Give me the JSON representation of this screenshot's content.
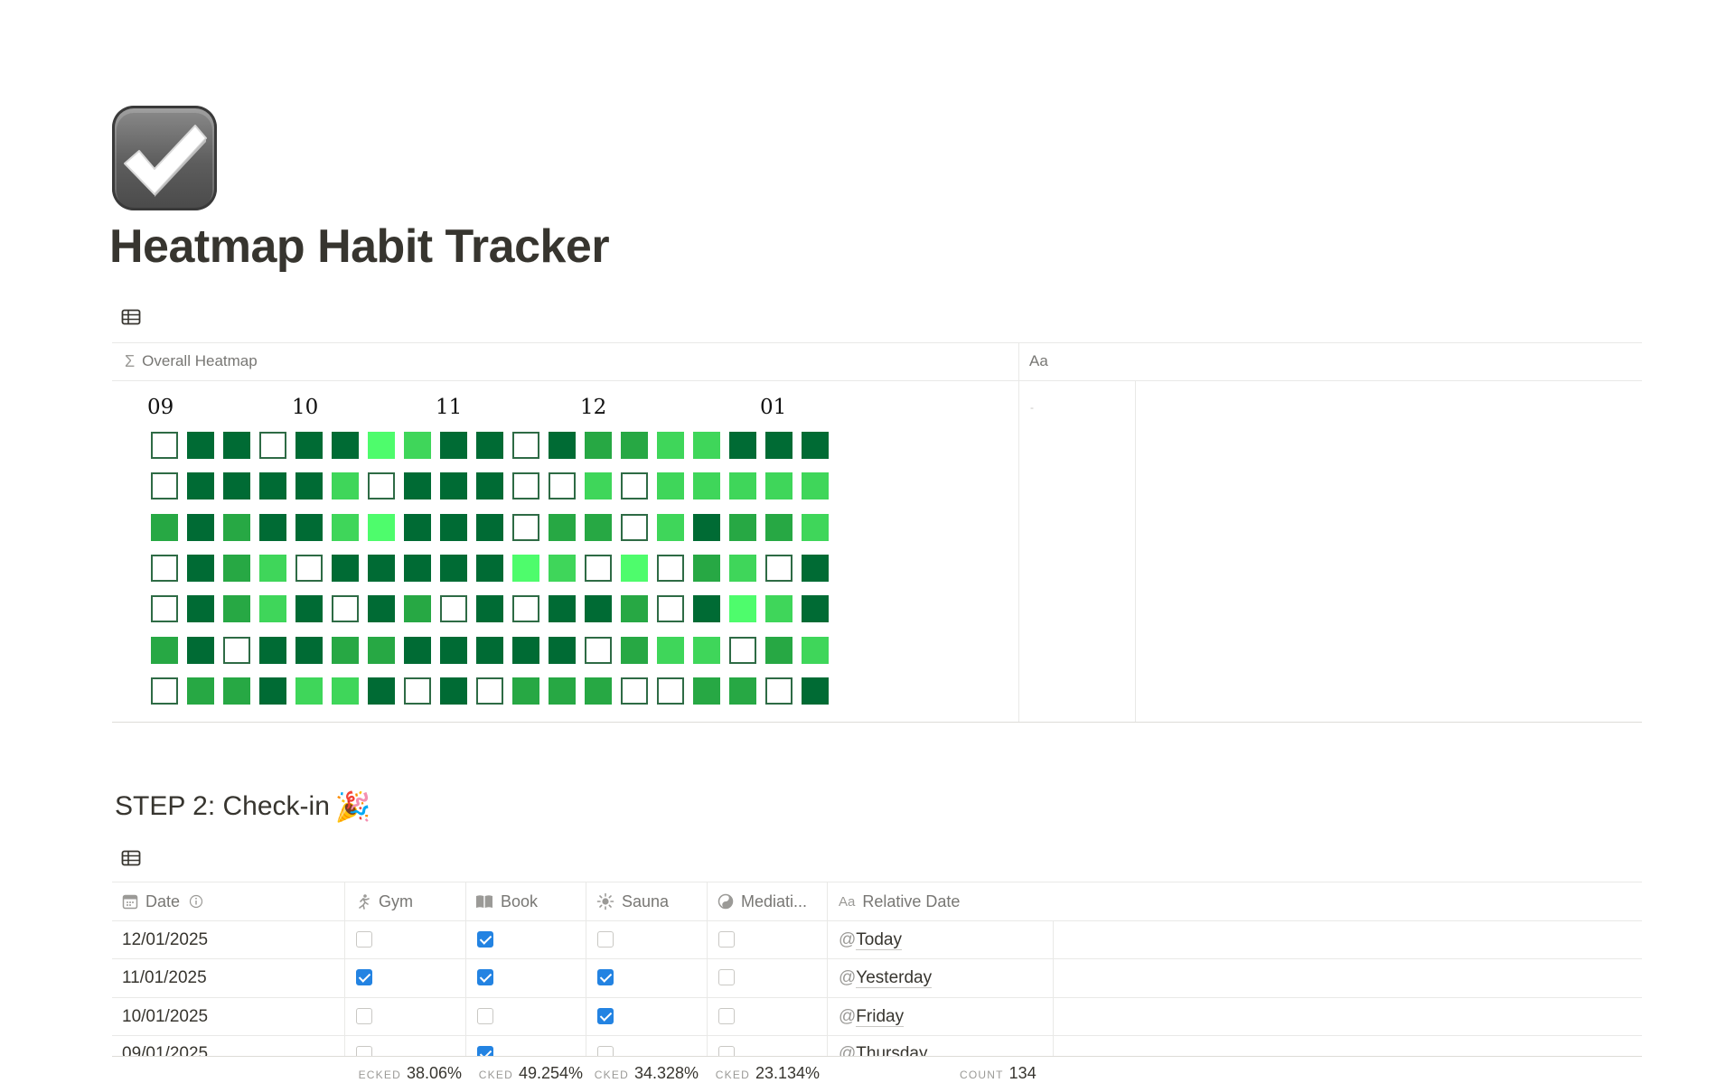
{
  "page": {
    "icon": "check-mark-button-icon",
    "title": "Heatmap Habit Tracker"
  },
  "heatmap_table": {
    "view_icon": "table-icon",
    "columns": [
      {
        "icon": "sigma-icon",
        "icon_glyph": "Σ",
        "label": "Overall Heatmap"
      },
      {
        "icon": "text-property-icon",
        "icon_glyph": "",
        "label": "Aa"
      }
    ],
    "empty_value": "-",
    "months": [
      "09",
      "10",
      "11",
      "12",
      "01"
    ],
    "colors": {
      "level_0": "#ffffff",
      "level_0_border": "#2e6b45",
      "level_1": "#4efc6c",
      "level_2": "#3fd65a",
      "level_3": "#27a844",
      "level_4": "#006b34"
    },
    "grid": [
      [
        0,
        4,
        4,
        0,
        4,
        4,
        1,
        2,
        4,
        4,
        0,
        4,
        3,
        3,
        2,
        2,
        4,
        4,
        4
      ],
      [
        0,
        4,
        4,
        4,
        4,
        2,
        0,
        4,
        4,
        4,
        0,
        0,
        2,
        0,
        2,
        2,
        2,
        2,
        2
      ],
      [
        3,
        4,
        3,
        4,
        4,
        2,
        1,
        4,
        4,
        4,
        0,
        3,
        3,
        0,
        2,
        4,
        3,
        3,
        2
      ],
      [
        0,
        4,
        3,
        2,
        0,
        4,
        4,
        4,
        4,
        4,
        1,
        2,
        0,
        1,
        0,
        3,
        2,
        0,
        4
      ],
      [
        0,
        4,
        3,
        2,
        4,
        0,
        4,
        3,
        0,
        4,
        0,
        4,
        4,
        3,
        0,
        4,
        1,
        2,
        4
      ],
      [
        3,
        4,
        0,
        4,
        4,
        3,
        3,
        4,
        4,
        4,
        4,
        4,
        0,
        3,
        2,
        2,
        0,
        3,
        2
      ],
      [
        0,
        3,
        3,
        4,
        2,
        2,
        4,
        0,
        4,
        0,
        3,
        3,
        3,
        0,
        0,
        3,
        3,
        0,
        4
      ]
    ]
  },
  "step2": {
    "heading": "STEP 2: Check-in",
    "heading_emoji": "🎉",
    "view_icon": "table-icon",
    "columns": [
      {
        "icon": "calendar-icon",
        "label": "Date",
        "info_icon": "info-icon"
      },
      {
        "icon": "running-person-icon",
        "label": "Gym"
      },
      {
        "icon": "open-book-icon",
        "label": "Book"
      },
      {
        "icon": "sun-icon",
        "label": "Sauna"
      },
      {
        "icon": "yin-yang-icon",
        "label": "Mediati..."
      },
      {
        "icon": "text-property-icon",
        "icon_glyph": "Aa",
        "label": "Relative Date"
      }
    ],
    "rows": [
      {
        "date": "12/01/2025",
        "gym": false,
        "book": true,
        "sauna": false,
        "meditation": false,
        "relative_at": "@",
        "relative": "Today"
      },
      {
        "date": "11/01/2025",
        "gym": true,
        "book": true,
        "sauna": true,
        "meditation": false,
        "relative_at": "@",
        "relative": "Yesterday"
      },
      {
        "date": "10/01/2025",
        "gym": false,
        "book": false,
        "sauna": true,
        "meditation": false,
        "relative_at": "@",
        "relative": "Friday"
      },
      {
        "date": "09/01/2025",
        "gym": false,
        "book": true,
        "sauna": false,
        "meditation": false,
        "relative_at": "@",
        "relative": "Thursday"
      }
    ],
    "footer": [
      {
        "label": "ECKED",
        "value": "38.06%"
      },
      {
        "label": "CKED",
        "value": "49.254%"
      },
      {
        "label": "CKED",
        "value": "34.328%"
      },
      {
        "label": "CKED",
        "value": "23.134%"
      },
      {
        "label": "COUNT",
        "value": "134"
      }
    ],
    "checkbox_color": "#2383e2"
  }
}
